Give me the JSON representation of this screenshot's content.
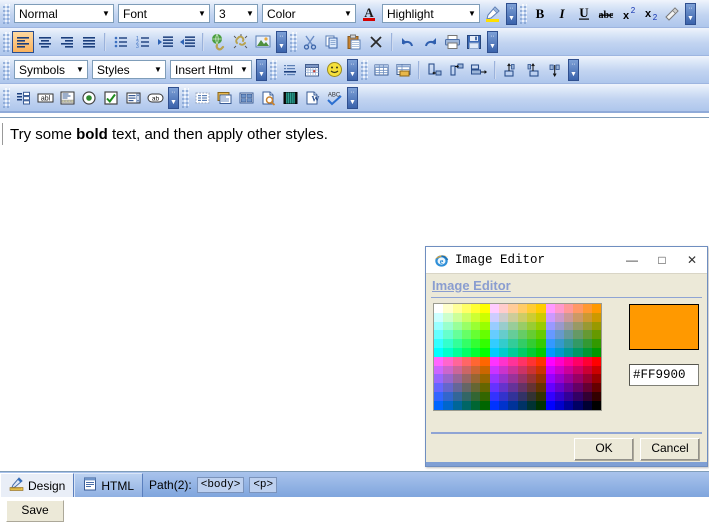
{
  "toolbar": {
    "row1": {
      "format_combo": {
        "value": "Normal",
        "arrow": "▼"
      },
      "font_combo": {
        "value": "Font",
        "arrow": "▼"
      },
      "size_combo": {
        "value": "3",
        "arrow": "▼"
      },
      "color_combo": {
        "value": "Color",
        "arrow": "▼"
      },
      "font_color_icon": "font-color-icon",
      "highlight_combo": {
        "value": "Highlight",
        "arrow": "▼"
      },
      "highlight_pen_icon": "highlight-pen-icon",
      "bold": "B",
      "italic": "I",
      "underline": "U",
      "strikethrough": "abc",
      "superscript": "x",
      "superscript_sup": "2",
      "subscript": "x",
      "subscript_sub": "2",
      "remove_format_icon": "eraser-icon"
    },
    "row2": {
      "align_left": "align-left-icon",
      "align_center": "align-center-icon",
      "align_right": "align-right-icon",
      "align_justify": "align-justify-icon",
      "bullet_list": "bullet-list-icon",
      "numbered_list": "numbered-list-icon",
      "indent": "indent-icon",
      "outdent": "outdent-icon",
      "insert_link": "insert-link-icon",
      "remove_link": "remove-link-icon",
      "insert_image": "insert-image-icon",
      "cut": "cut-icon",
      "copy": "copy-icon",
      "paste": "paste-icon",
      "delete": "delete-icon",
      "undo": "undo-icon",
      "redo": "redo-icon",
      "print": "print-icon",
      "save": "save-disk-icon"
    },
    "row3": {
      "symbols_combo": {
        "value": "Symbols",
        "arrow": "▼"
      },
      "styles_combo": {
        "value": "Styles",
        "arrow": "▼"
      },
      "insert_html_combo": {
        "value": "Insert Html",
        "arrow": "▼"
      },
      "insert_rule": "horizontal-rule-icon",
      "insert_calendar": "calendar-icon",
      "insert_emoticon": "emoticon-icon",
      "insert_table": "insert-table-icon",
      "table_properties": "table-properties-icon",
      "insert_row": "insert-row-icon",
      "insert_cell": "insert-cell-icon",
      "merge_cells": "merge-cells-icon",
      "insert_column_left": "insert-column-left-icon",
      "insert_column_right": "insert-column-right-icon",
      "delete_column": "delete-column-icon"
    },
    "row4": {
      "form": "form-icon",
      "textbox": "textbox-icon",
      "textarea": "textarea-icon",
      "radio_button": "radio-button-icon",
      "checkbox": "checkbox-icon",
      "select_list": "select-list-icon",
      "button": "form-button-icon",
      "bookmark": "bookmark-icon",
      "snippets": "snippets-icon",
      "gallery": "gallery-icon",
      "preview": "preview-icon",
      "media": "media-icon",
      "word_paste": "word-paste-icon",
      "spellcheck": "spellcheck-icon"
    }
  },
  "editor": {
    "content_prefix": "Try some ",
    "content_bold": "bold",
    "content_suffix": " text, and then apply other styles."
  },
  "status": {
    "design_tab": "Design",
    "design_icon": "design-pencil-icon",
    "html_tab": "HTML",
    "html_icon": "html-document-icon",
    "path_label": "Path(2):",
    "path_tags": [
      "<body>",
      "<p>"
    ]
  },
  "save_button": "Save",
  "dialog": {
    "icon": "internet-explorer-icon",
    "title": "Image Editor",
    "minimize": "—",
    "maximize": "□",
    "close": "✕",
    "heading": "Image Editor",
    "selected_color": "#FF9900",
    "hex_value": "#FF9900",
    "ok_button": "OK",
    "cancel_button": "Cancel",
    "palette": {
      "columns": 18,
      "rows": 12,
      "colors": [
        [
          "#FFFFFF",
          "#FFFFCC",
          "#FFFF99",
          "#FFFF66",
          "#FFFF33",
          "#FFFF00",
          "#FFCCFF",
          "#FFCCCC",
          "#FFCC99",
          "#FFCC66",
          "#FFCC33",
          "#FFCC00",
          "#FF99FF",
          "#FF99CC",
          "#FF9999",
          "#FF9966",
          "#FF9933",
          "#FF9900"
        ],
        [
          "#CCFFFF",
          "#CCFFCC",
          "#CCFF99",
          "#CCFF66",
          "#CCFF33",
          "#CCFF00",
          "#CCCCFF",
          "#CCCCCC",
          "#CCCC99",
          "#CCCC66",
          "#CCCC33",
          "#CCCC00",
          "#CC99FF",
          "#CC99CC",
          "#CC9999",
          "#CC9966",
          "#CC9933",
          "#CC9900"
        ],
        [
          "#99FFFF",
          "#99FFCC",
          "#99FF99",
          "#99FF66",
          "#99FF33",
          "#99FF00",
          "#99CCFF",
          "#99CCCC",
          "#99CC99",
          "#99CC66",
          "#99CC33",
          "#99CC00",
          "#9999FF",
          "#9999CC",
          "#999999",
          "#999966",
          "#999933",
          "#999900"
        ],
        [
          "#66FFFF",
          "#66FFCC",
          "#66FF99",
          "#66FF66",
          "#66FF33",
          "#66FF00",
          "#66CCFF",
          "#66CCCC",
          "#66CC99",
          "#66CC66",
          "#66CC33",
          "#66CC00",
          "#6699FF",
          "#6699CC",
          "#669999",
          "#669966",
          "#669933",
          "#669900"
        ],
        [
          "#33FFFF",
          "#33FFCC",
          "#33FF99",
          "#33FF66",
          "#33FF33",
          "#33FF00",
          "#33CCFF",
          "#33CCCC",
          "#33CC99",
          "#33CC66",
          "#33CC33",
          "#33CC00",
          "#3399FF",
          "#3399CC",
          "#339999",
          "#339966",
          "#339933",
          "#339900"
        ],
        [
          "#00FFFF",
          "#00FFCC",
          "#00FF99",
          "#00FF66",
          "#00FF33",
          "#00FF00",
          "#00CCFF",
          "#00CCCC",
          "#00CC99",
          "#00CC66",
          "#00CC33",
          "#00CC00",
          "#0099FF",
          "#0099CC",
          "#009999",
          "#009966",
          "#009933",
          "#009900"
        ],
        [
          "#FF66FF",
          "#FF66CC",
          "#FF6699",
          "#FF6666",
          "#FF6633",
          "#FF6600",
          "#FF33FF",
          "#FF33CC",
          "#FF3399",
          "#FF3366",
          "#FF3333",
          "#FF3300",
          "#FF00FF",
          "#FF00CC",
          "#FF0099",
          "#FF0066",
          "#FF0033",
          "#FF0000"
        ],
        [
          "#CC66FF",
          "#CC66CC",
          "#CC6699",
          "#CC6666",
          "#CC6633",
          "#CC6600",
          "#CC33FF",
          "#CC33CC",
          "#CC3399",
          "#CC3366",
          "#CC3333",
          "#CC3300",
          "#CC00FF",
          "#CC00CC",
          "#CC0099",
          "#CC0066",
          "#CC0033",
          "#CC0000"
        ],
        [
          "#9966FF",
          "#9966CC",
          "#996699",
          "#996666",
          "#996633",
          "#996600",
          "#9933FF",
          "#9933CC",
          "#993399",
          "#993366",
          "#993333",
          "#993300",
          "#9900FF",
          "#9900CC",
          "#990099",
          "#990066",
          "#990033",
          "#990000"
        ],
        [
          "#6666FF",
          "#6666CC",
          "#666699",
          "#666666",
          "#666633",
          "#666600",
          "#6633FF",
          "#6633CC",
          "#663399",
          "#663366",
          "#663333",
          "#663300",
          "#6600FF",
          "#6600CC",
          "#660099",
          "#660066",
          "#660033",
          "#660000"
        ],
        [
          "#3366FF",
          "#3366CC",
          "#336699",
          "#336666",
          "#336633",
          "#336600",
          "#3333FF",
          "#3333CC",
          "#333399",
          "#333366",
          "#333333",
          "#333300",
          "#3300FF",
          "#3300CC",
          "#330099",
          "#330066",
          "#330033",
          "#330000"
        ],
        [
          "#0066FF",
          "#0066CC",
          "#006699",
          "#006666",
          "#006633",
          "#006600",
          "#0033FF",
          "#0033CC",
          "#003399",
          "#003366",
          "#003333",
          "#003300",
          "#0000FF",
          "#0000CC",
          "#000099",
          "#000066",
          "#000033",
          "#000000"
        ]
      ]
    }
  }
}
